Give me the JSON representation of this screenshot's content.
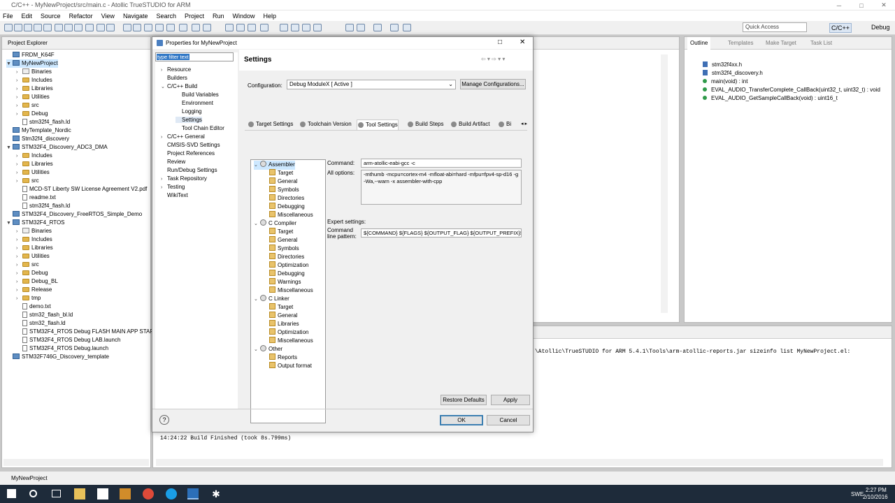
{
  "window": {
    "title": "C/C++ - MyNewProject/src/main.c - Atollic TrueSTUDIO for ARM",
    "min": "─",
    "max": "□",
    "close": "✕"
  },
  "menu": [
    "File",
    "Edit",
    "Source",
    "Refactor",
    "View",
    "Navigate",
    "Search",
    "Project",
    "Run",
    "Window",
    "Help"
  ],
  "toolbar": {
    "quick_access": "Quick Access",
    "persp_cpp": "C/C++",
    "persp_debug": "Debug"
  },
  "project_explorer": {
    "tab": "Project Explorer",
    "items": [
      {
        "label": "FRDM_K64F",
        "kind": "proj",
        "indent": 0,
        "tw": ""
      },
      {
        "label": "MyNewProject",
        "kind": "proj",
        "indent": 0,
        "tw": "▼",
        "sel": true
      },
      {
        "label": "Binaries",
        "kind": "bin",
        "indent": 1,
        "tw": "›"
      },
      {
        "label": "Includes",
        "kind": "folder",
        "indent": 1,
        "tw": "›"
      },
      {
        "label": "Libraries",
        "kind": "folder",
        "indent": 1,
        "tw": "›"
      },
      {
        "label": "Utilities",
        "kind": "folder",
        "indent": 1,
        "tw": "›"
      },
      {
        "label": "src",
        "kind": "folder",
        "indent": 1,
        "tw": "›"
      },
      {
        "label": "Debug",
        "kind": "folder",
        "indent": 1,
        "tw": "›"
      },
      {
        "label": "stm32f4_flash.ld",
        "kind": "file",
        "indent": 1,
        "tw": ""
      },
      {
        "label": "MyTemplate_Nordic",
        "kind": "proj",
        "indent": 0,
        "tw": ""
      },
      {
        "label": "Stm32f4_discovery",
        "kind": "proj",
        "indent": 0,
        "tw": ""
      },
      {
        "label": "STM32F4_Discovery_ADC3_DMA",
        "kind": "proj",
        "indent": 0,
        "tw": "▼"
      },
      {
        "label": "Includes",
        "kind": "folder",
        "indent": 1,
        "tw": "›"
      },
      {
        "label": "Libraries",
        "kind": "folder",
        "indent": 1,
        "tw": "›"
      },
      {
        "label": "Utilities",
        "kind": "folder",
        "indent": 1,
        "tw": "›"
      },
      {
        "label": "src",
        "kind": "folder",
        "indent": 1,
        "tw": "›"
      },
      {
        "label": "MCD-ST Liberty SW License Agreement V2.pdf",
        "kind": "file",
        "indent": 1,
        "tw": ""
      },
      {
        "label": "readme.txt",
        "kind": "file",
        "indent": 1,
        "tw": ""
      },
      {
        "label": "stm32f4_flash.ld",
        "kind": "file",
        "indent": 1,
        "tw": ""
      },
      {
        "label": "STM32F4_Discovery_FreeRTOS_Simple_Demo",
        "kind": "proj",
        "indent": 0,
        "tw": ""
      },
      {
        "label": "STM32F4_RTOS",
        "kind": "proj",
        "indent": 0,
        "tw": "▼"
      },
      {
        "label": "Binaries",
        "kind": "bin",
        "indent": 1,
        "tw": "›"
      },
      {
        "label": "Includes",
        "kind": "folder",
        "indent": 1,
        "tw": "›"
      },
      {
        "label": "Libraries",
        "kind": "folder",
        "indent": 1,
        "tw": "›"
      },
      {
        "label": "Utilities",
        "kind": "folder",
        "indent": 1,
        "tw": "›"
      },
      {
        "label": "src",
        "kind": "folder",
        "indent": 1,
        "tw": "›"
      },
      {
        "label": "Debug",
        "kind": "folder",
        "indent": 1,
        "tw": "›"
      },
      {
        "label": "Debug_BL",
        "kind": "folder",
        "indent": 1,
        "tw": "›"
      },
      {
        "label": "Release",
        "kind": "folder",
        "indent": 1,
        "tw": "›"
      },
      {
        "label": "tmp",
        "kind": "folder",
        "indent": 1,
        "tw": "›"
      },
      {
        "label": "demo.txt",
        "kind": "file",
        "indent": 1,
        "tw": ""
      },
      {
        "label": "stm32_flash_bl.ld",
        "kind": "file",
        "indent": 1,
        "tw": ""
      },
      {
        "label": "stm32_flash.ld",
        "kind": "file",
        "indent": 1,
        "tw": ""
      },
      {
        "label": "STM32F4_RTOS Debug FLASH MAIN APP STAR",
        "kind": "file",
        "indent": 1,
        "tw": ""
      },
      {
        "label": "STM32F4_RTOS Debug LAB.launch",
        "kind": "file",
        "indent": 1,
        "tw": ""
      },
      {
        "label": "STM32F4_RTOS Debug.launch",
        "kind": "file",
        "indent": 1,
        "tw": ""
      },
      {
        "label": "STM32F746G_Discovery_template",
        "kind": "proj",
        "indent": 0,
        "tw": ""
      }
    ]
  },
  "dialog": {
    "title": "Properties for MyNewProject",
    "filter": "type filter text",
    "nav": [
      {
        "label": "Resource",
        "indent": 0,
        "tw": "›"
      },
      {
        "label": "Builders",
        "indent": 0,
        "tw": ""
      },
      {
        "label": "C/C++ Build",
        "indent": 0,
        "tw": "⌄"
      },
      {
        "label": "Build Variables",
        "indent": 1,
        "tw": ""
      },
      {
        "label": "Environment",
        "indent": 1,
        "tw": ""
      },
      {
        "label": "Logging",
        "indent": 1,
        "tw": ""
      },
      {
        "label": "Settings",
        "indent": 1,
        "tw": "",
        "sel": true
      },
      {
        "label": "Tool Chain Editor",
        "indent": 1,
        "tw": ""
      },
      {
        "label": "C/C++ General",
        "indent": 0,
        "tw": "›"
      },
      {
        "label": "CMSIS-SVD Settings",
        "indent": 0,
        "tw": ""
      },
      {
        "label": "Project References",
        "indent": 0,
        "tw": ""
      },
      {
        "label": "Review",
        "indent": 0,
        "tw": ""
      },
      {
        "label": "Run/Debug Settings",
        "indent": 0,
        "tw": ""
      },
      {
        "label": "Task Repository",
        "indent": 0,
        "tw": "›"
      },
      {
        "label": "Testing",
        "indent": 0,
        "tw": "›"
      },
      {
        "label": "WikiText",
        "indent": 0,
        "tw": ""
      }
    ],
    "heading": "Settings",
    "config_label": "Configuration:",
    "config_value": "Debug ModuleX  [ Active ]",
    "manage": "Manage Configurations...",
    "tabs": [
      "Target Settings",
      "Toolchain Version",
      "Tool Settings",
      "Build Steps",
      "Build Artifact",
      "Bi"
    ],
    "tool_tree": [
      {
        "label": "Assembler",
        "level": 0,
        "tw": "⌄",
        "sel": true
      },
      {
        "label": "Target",
        "level": 1
      },
      {
        "label": "General",
        "level": 1
      },
      {
        "label": "Symbols",
        "level": 1
      },
      {
        "label": "Directories",
        "level": 1
      },
      {
        "label": "Debugging",
        "level": 1
      },
      {
        "label": "Miscellaneous",
        "level": 1
      },
      {
        "label": "C Compiler",
        "level": 0,
        "tw": "⌄"
      },
      {
        "label": "Target",
        "level": 1
      },
      {
        "label": "General",
        "level": 1
      },
      {
        "label": "Symbols",
        "level": 1
      },
      {
        "label": "Directories",
        "level": 1
      },
      {
        "label": "Optimization",
        "level": 1
      },
      {
        "label": "Debugging",
        "level": 1
      },
      {
        "label": "Warnings",
        "level": 1
      },
      {
        "label": "Miscellaneous",
        "level": 1
      },
      {
        "label": "C Linker",
        "level": 0,
        "tw": "⌄"
      },
      {
        "label": "Target",
        "level": 1
      },
      {
        "label": "General",
        "level": 1
      },
      {
        "label": "Libraries",
        "level": 1
      },
      {
        "label": "Optimization",
        "level": 1
      },
      {
        "label": "Miscellaneous",
        "level": 1
      },
      {
        "label": "Other",
        "level": 0,
        "tw": "⌄"
      },
      {
        "label": "Reports",
        "level": 1
      },
      {
        "label": "Output format",
        "level": 1
      }
    ],
    "command_label": "Command:",
    "command_value": "arm-atollic-eabi-gcc -c",
    "all_options_label": "All options:",
    "all_options_value": "-mthumb -mcpu=cortex-m4 -mfloat-abi=hard -mfpu=fpv4-sp-d16 -g -Wa,--warn -x assembler-with-cpp",
    "expert_label": "Expert settings:",
    "pattern_label1": "Command",
    "pattern_label2": "line pattern:",
    "pattern_value": "${COMMAND} ${FLAGS} ${OUTPUT_FLAG} ${OUTPUT_PREFIX}${",
    "restore": "Restore Defaults",
    "apply": "Apply",
    "ok": "OK",
    "cancel": "Cancel",
    "help": "?"
  },
  "outline": {
    "tabs": [
      "Outline",
      "Templates",
      "Make Target",
      "Task List"
    ],
    "items": [
      {
        "label": "stm32f4xx.h",
        "kind": "hdr"
      },
      {
        "label": "stm32f4_discovery.h",
        "kind": "hdr"
      },
      {
        "label": "main(void) : int",
        "kind": "dot"
      },
      {
        "label": "EVAL_AUDIO_TransferComplete_CallBack(uint32_t, uint32_t) : void",
        "kind": "dot"
      },
      {
        "label": "EVAL_AUDIO_GetSampleCallBack(void) : uint16_t",
        "kind": "dot"
      }
    ]
  },
  "console": {
    "line1": "\\Atollic\\TrueSTUDIO for ARM 5.4.1\\Tools\\arm-atollic-reports.jar sizeinfo list MyNewProject.el:",
    "line2": "14:24:22 Build Finished (took 8s.799ms)"
  },
  "status": {
    "project": "MyNewProject"
  },
  "tray": {
    "time": "2:27 PM",
    "date": "2/10/2016",
    "lang": "SWE"
  }
}
